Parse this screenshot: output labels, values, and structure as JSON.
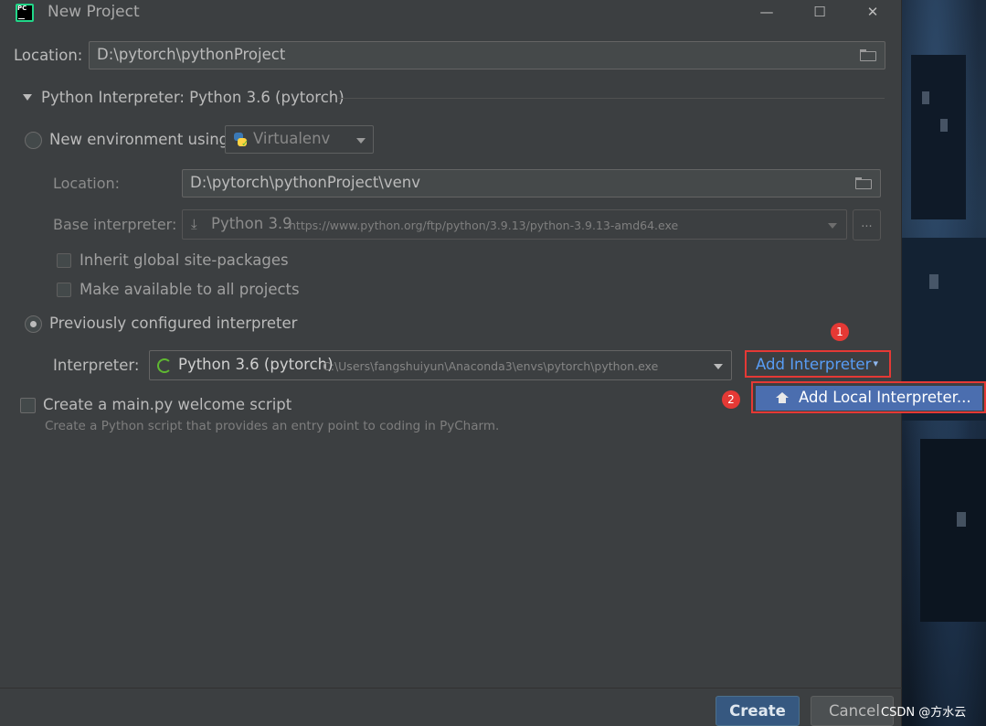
{
  "window": {
    "title": "New Project",
    "minimize": "—",
    "maximize": "☐",
    "close": "✕"
  },
  "location": {
    "label": "Location:",
    "value": "D:\\pytorch\\pythonProject"
  },
  "interpreter_section": {
    "title": "Python Interpreter: Python 3.6 (pytorch)",
    "new_env": {
      "label": "New environment using",
      "tool": "Virtualenv",
      "location_label": "Location:",
      "location_value": "D:\\pytorch\\pythonProject\\venv",
      "base_label": "Base interpreter:",
      "base_name": "Python 3.9",
      "base_url": "https://www.python.org/ftp/python/3.9.13/python-3.9.13-amd64.exe",
      "browse": "...",
      "inherit_label": "Inherit global site-packages",
      "available_label": "Make available to all projects"
    },
    "previous": {
      "label": "Previously configured interpreter",
      "interpreter_label": "Interpreter:",
      "interpreter_name": "Python 3.6 (pytorch)",
      "interpreter_path": "C:\\Users\\fangshuiyun\\Anaconda3\\envs\\pytorch\\python.exe",
      "add_button": "Add Interpreter",
      "add_chevron": "⌄"
    },
    "popup_item": "Add Local Interpreter..."
  },
  "welcome": {
    "label": "Create a main.py welcome script",
    "description": "Create a Python script that provides an entry point to coding in PyCharm."
  },
  "annotations": {
    "badge1": "1",
    "badge2": "2"
  },
  "footer": {
    "create": "Create",
    "cancel": "Cancel"
  },
  "watermark": "CSDN @方水云"
}
